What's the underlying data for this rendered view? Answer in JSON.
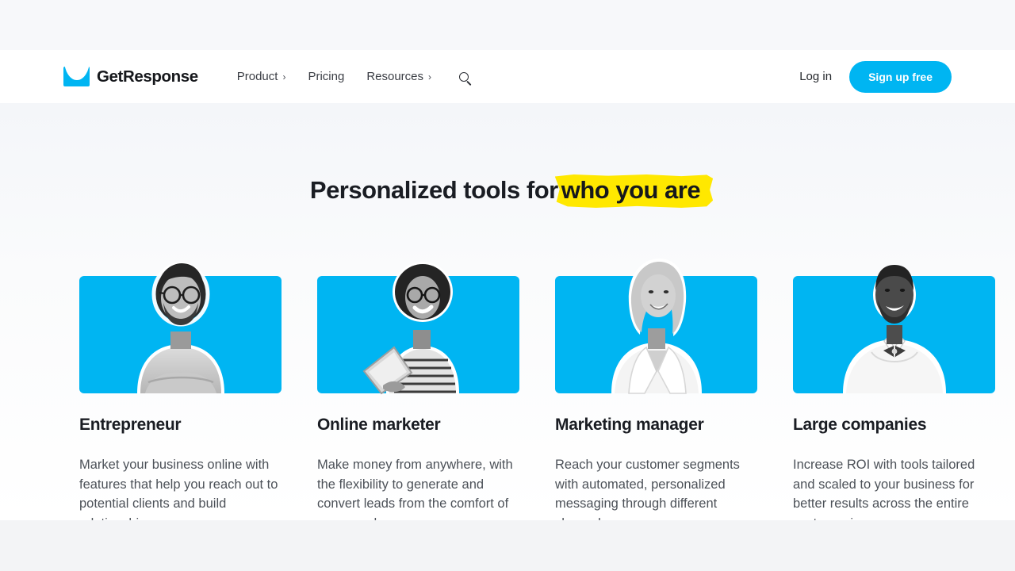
{
  "header": {
    "brand_name": "GetResponse",
    "brand_icon": "envelope-icon",
    "nav": [
      {
        "label": "Product",
        "has_chevron": true,
        "chevron": "›"
      },
      {
        "label": "Pricing",
        "has_chevron": false,
        "chevron": ""
      },
      {
        "label": "Resources",
        "has_chevron": true,
        "chevron": "›"
      }
    ],
    "search_icon": "search-icon",
    "login_label": "Log in",
    "signup_label": "Sign up free"
  },
  "hero": {
    "headline_prefix": "Personalized tools for",
    "headline_highlight": "who you are",
    "highlight_color": "#ffe800"
  },
  "cards": [
    {
      "title": "Entrepreneur",
      "description": "Market your business online with features that help you reach out to potential clients and build relationships.",
      "image_alt": "man-with-glasses-portrait",
      "bg_color": "#00b5f2"
    },
    {
      "title": "Online marketer",
      "description": "Make money from anywhere, with the flexibility to generate and convert leads from the comfort of your own home.",
      "image_alt": "woman-with-tablet-portrait",
      "bg_color": "#00b5f2"
    },
    {
      "title": "Marketing manager",
      "description": "Reach your customer segments with automated, personalized messaging through different channels.",
      "image_alt": "blonde-woman-in-blazer-portrait",
      "bg_color": "#00b5f2"
    },
    {
      "title": "Large companies",
      "description": "Increase ROI with tools tailored and scaled to your business for better results across the entire customer journey.",
      "image_alt": "man-in-white-sweater-portrait",
      "bg_color": "#00b5f2"
    }
  ],
  "theme": {
    "accent": "#00b5f2",
    "text_dark": "#1a1d23",
    "text_body": "#4c5158",
    "page_bg": "#f7f8fa"
  }
}
